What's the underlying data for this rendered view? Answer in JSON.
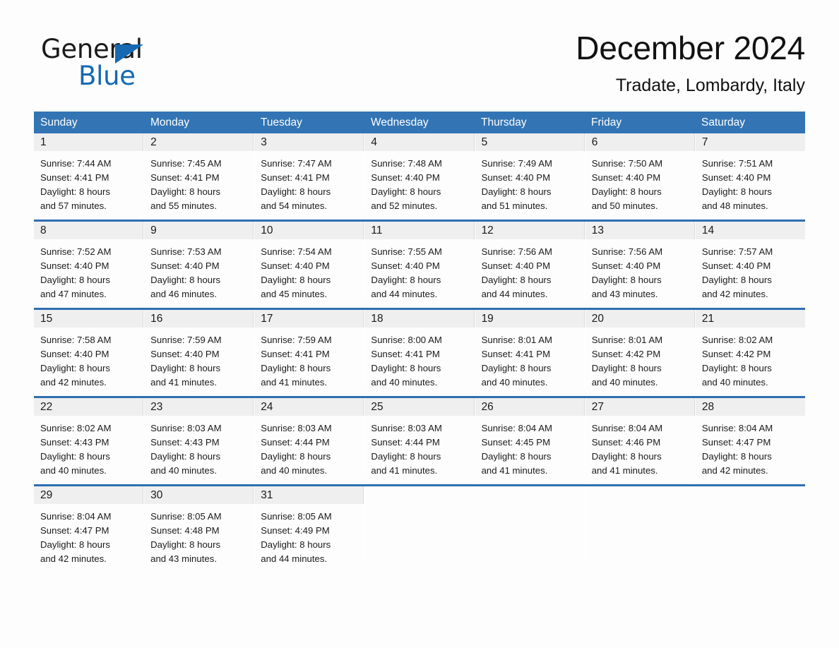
{
  "brand": {
    "name_part1": "General",
    "name_part2": "Blue",
    "triangle_color": "#1569b2"
  },
  "header": {
    "month_title": "December 2024",
    "location": "Tradate, Lombardy, Italy"
  },
  "theme": {
    "header_blue": "#3274b4",
    "row_separator_blue": "#2d6fb0",
    "daynum_background": "#efefef",
    "page_background": "#fdfdfd"
  },
  "weekday_headers": [
    "Sunday",
    "Monday",
    "Tuesday",
    "Wednesday",
    "Thursday",
    "Friday",
    "Saturday"
  ],
  "weeks": [
    [
      {
        "day": "1",
        "sunrise": "Sunrise: 7:44 AM",
        "sunset": "Sunset: 4:41 PM",
        "daylight_line1": "Daylight: 8 hours",
        "daylight_line2": "and 57 minutes."
      },
      {
        "day": "2",
        "sunrise": "Sunrise: 7:45 AM",
        "sunset": "Sunset: 4:41 PM",
        "daylight_line1": "Daylight: 8 hours",
        "daylight_line2": "and 55 minutes."
      },
      {
        "day": "3",
        "sunrise": "Sunrise: 7:47 AM",
        "sunset": "Sunset: 4:41 PM",
        "daylight_line1": "Daylight: 8 hours",
        "daylight_line2": "and 54 minutes."
      },
      {
        "day": "4",
        "sunrise": "Sunrise: 7:48 AM",
        "sunset": "Sunset: 4:40 PM",
        "daylight_line1": "Daylight: 8 hours",
        "daylight_line2": "and 52 minutes."
      },
      {
        "day": "5",
        "sunrise": "Sunrise: 7:49 AM",
        "sunset": "Sunset: 4:40 PM",
        "daylight_line1": "Daylight: 8 hours",
        "daylight_line2": "and 51 minutes."
      },
      {
        "day": "6",
        "sunrise": "Sunrise: 7:50 AM",
        "sunset": "Sunset: 4:40 PM",
        "daylight_line1": "Daylight: 8 hours",
        "daylight_line2": "and 50 minutes."
      },
      {
        "day": "7",
        "sunrise": "Sunrise: 7:51 AM",
        "sunset": "Sunset: 4:40 PM",
        "daylight_line1": "Daylight: 8 hours",
        "daylight_line2": "and 48 minutes."
      }
    ],
    [
      {
        "day": "8",
        "sunrise": "Sunrise: 7:52 AM",
        "sunset": "Sunset: 4:40 PM",
        "daylight_line1": "Daylight: 8 hours",
        "daylight_line2": "and 47 minutes."
      },
      {
        "day": "9",
        "sunrise": "Sunrise: 7:53 AM",
        "sunset": "Sunset: 4:40 PM",
        "daylight_line1": "Daylight: 8 hours",
        "daylight_line2": "and 46 minutes."
      },
      {
        "day": "10",
        "sunrise": "Sunrise: 7:54 AM",
        "sunset": "Sunset: 4:40 PM",
        "daylight_line1": "Daylight: 8 hours",
        "daylight_line2": "and 45 minutes."
      },
      {
        "day": "11",
        "sunrise": "Sunrise: 7:55 AM",
        "sunset": "Sunset: 4:40 PM",
        "daylight_line1": "Daylight: 8 hours",
        "daylight_line2": "and 44 minutes."
      },
      {
        "day": "12",
        "sunrise": "Sunrise: 7:56 AM",
        "sunset": "Sunset: 4:40 PM",
        "daylight_line1": "Daylight: 8 hours",
        "daylight_line2": "and 44 minutes."
      },
      {
        "day": "13",
        "sunrise": "Sunrise: 7:56 AM",
        "sunset": "Sunset: 4:40 PM",
        "daylight_line1": "Daylight: 8 hours",
        "daylight_line2": "and 43 minutes."
      },
      {
        "day": "14",
        "sunrise": "Sunrise: 7:57 AM",
        "sunset": "Sunset: 4:40 PM",
        "daylight_line1": "Daylight: 8 hours",
        "daylight_line2": "and 42 minutes."
      }
    ],
    [
      {
        "day": "15",
        "sunrise": "Sunrise: 7:58 AM",
        "sunset": "Sunset: 4:40 PM",
        "daylight_line1": "Daylight: 8 hours",
        "daylight_line2": "and 42 minutes."
      },
      {
        "day": "16",
        "sunrise": "Sunrise: 7:59 AM",
        "sunset": "Sunset: 4:40 PM",
        "daylight_line1": "Daylight: 8 hours",
        "daylight_line2": "and 41 minutes."
      },
      {
        "day": "17",
        "sunrise": "Sunrise: 7:59 AM",
        "sunset": "Sunset: 4:41 PM",
        "daylight_line1": "Daylight: 8 hours",
        "daylight_line2": "and 41 minutes."
      },
      {
        "day": "18",
        "sunrise": "Sunrise: 8:00 AM",
        "sunset": "Sunset: 4:41 PM",
        "daylight_line1": "Daylight: 8 hours",
        "daylight_line2": "and 40 minutes."
      },
      {
        "day": "19",
        "sunrise": "Sunrise: 8:01 AM",
        "sunset": "Sunset: 4:41 PM",
        "daylight_line1": "Daylight: 8 hours",
        "daylight_line2": "and 40 minutes."
      },
      {
        "day": "20",
        "sunrise": "Sunrise: 8:01 AM",
        "sunset": "Sunset: 4:42 PM",
        "daylight_line1": "Daylight: 8 hours",
        "daylight_line2": "and 40 minutes."
      },
      {
        "day": "21",
        "sunrise": "Sunrise: 8:02 AM",
        "sunset": "Sunset: 4:42 PM",
        "daylight_line1": "Daylight: 8 hours",
        "daylight_line2": "and 40 minutes."
      }
    ],
    [
      {
        "day": "22",
        "sunrise": "Sunrise: 8:02 AM",
        "sunset": "Sunset: 4:43 PM",
        "daylight_line1": "Daylight: 8 hours",
        "daylight_line2": "and 40 minutes."
      },
      {
        "day": "23",
        "sunrise": "Sunrise: 8:03 AM",
        "sunset": "Sunset: 4:43 PM",
        "daylight_line1": "Daylight: 8 hours",
        "daylight_line2": "and 40 minutes."
      },
      {
        "day": "24",
        "sunrise": "Sunrise: 8:03 AM",
        "sunset": "Sunset: 4:44 PM",
        "daylight_line1": "Daylight: 8 hours",
        "daylight_line2": "and 40 minutes."
      },
      {
        "day": "25",
        "sunrise": "Sunrise: 8:03 AM",
        "sunset": "Sunset: 4:44 PM",
        "daylight_line1": "Daylight: 8 hours",
        "daylight_line2": "and 41 minutes."
      },
      {
        "day": "26",
        "sunrise": "Sunrise: 8:04 AM",
        "sunset": "Sunset: 4:45 PM",
        "daylight_line1": "Daylight: 8 hours",
        "daylight_line2": "and 41 minutes."
      },
      {
        "day": "27",
        "sunrise": "Sunrise: 8:04 AM",
        "sunset": "Sunset: 4:46 PM",
        "daylight_line1": "Daylight: 8 hours",
        "daylight_line2": "and 41 minutes."
      },
      {
        "day": "28",
        "sunrise": "Sunrise: 8:04 AM",
        "sunset": "Sunset: 4:47 PM",
        "daylight_line1": "Daylight: 8 hours",
        "daylight_line2": "and 42 minutes."
      }
    ],
    [
      {
        "day": "29",
        "sunrise": "Sunrise: 8:04 AM",
        "sunset": "Sunset: 4:47 PM",
        "daylight_line1": "Daylight: 8 hours",
        "daylight_line2": "and 42 minutes."
      },
      {
        "day": "30",
        "sunrise": "Sunrise: 8:05 AM",
        "sunset": "Sunset: 4:48 PM",
        "daylight_line1": "Daylight: 8 hours",
        "daylight_line2": "and 43 minutes."
      },
      {
        "day": "31",
        "sunrise": "Sunrise: 8:05 AM",
        "sunset": "Sunset: 4:49 PM",
        "daylight_line1": "Daylight: 8 hours",
        "daylight_line2": "and 44 minutes."
      },
      {
        "day": "",
        "sunrise": "",
        "sunset": "",
        "daylight_line1": "",
        "daylight_line2": ""
      },
      {
        "day": "",
        "sunrise": "",
        "sunset": "",
        "daylight_line1": "",
        "daylight_line2": ""
      },
      {
        "day": "",
        "sunrise": "",
        "sunset": "",
        "daylight_line1": "",
        "daylight_line2": ""
      },
      {
        "day": "",
        "sunrise": "",
        "sunset": "",
        "daylight_line1": "",
        "daylight_line2": ""
      }
    ]
  ]
}
